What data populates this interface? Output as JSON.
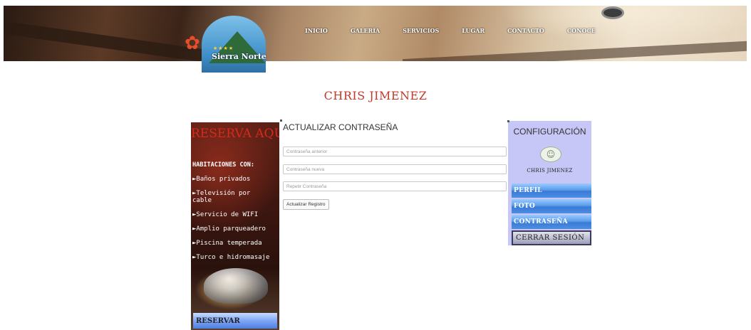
{
  "logo": {
    "name": "Sierra Norte",
    "stars": "★★★★"
  },
  "nav": [
    "INICIO",
    "GALERÍA",
    "SERVICIOS",
    "LUGAR",
    "CONTACTO",
    "CONOCE"
  ],
  "user_title": "CHRIS JIMENEZ",
  "left_panel": {
    "title": "RESERVA AQUI",
    "habitaciones_title": "HABITACIONES CON:",
    "amenities": [
      "►Baños privados",
      "►Televisión por\ncable",
      "►Servicio de WIFI",
      "►Amplio parqueadero",
      "►Piscina temperada",
      "►Turco e hidromasaje"
    ],
    "reserve_button": "RESERVAR"
  },
  "form": {
    "title": "ACTUALIZAR CONTRASEÑA",
    "old_password_placeholder": "Contraseña anterior",
    "new_password_placeholder": "Contraseña nueva",
    "repeat_password_placeholder": "Repetir Contraseña",
    "submit_label": "Actualizar Registro"
  },
  "right_panel": {
    "title": "CONFIGURACIÓN",
    "profile_name": "CHRIS JIMENEZ",
    "menu": [
      "PERFIL",
      "FOTO",
      "CONTRASEÑA"
    ],
    "logout": "CERRAR SESIÓN"
  },
  "colors": {
    "accent_red": "#c0392b",
    "panel_lavender": "#c6c6f7",
    "menu_blue": "#4d8ee3"
  }
}
